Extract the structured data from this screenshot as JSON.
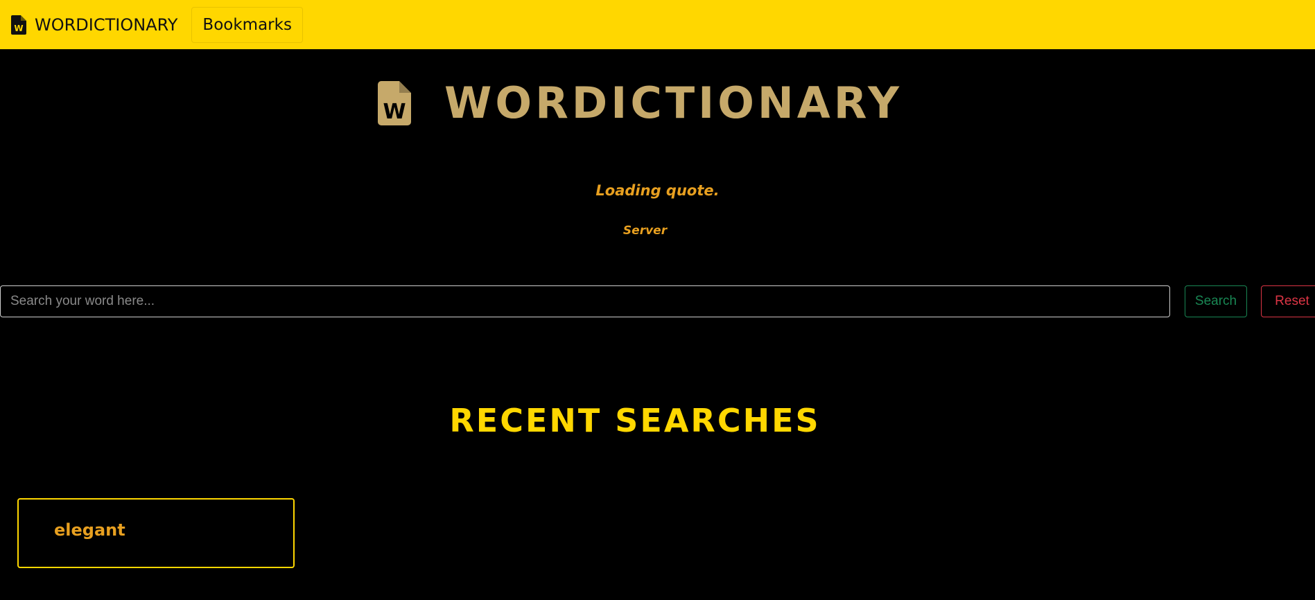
{
  "navbar": {
    "brand_label": "WORDICTIONARY",
    "brand_icon": "file-word-icon",
    "bookmarks_label": "Bookmarks",
    "background_color": "#FFD700"
  },
  "hero": {
    "title": "WORDICTIONARY",
    "icon": "file-word-icon",
    "color": "#C6A96A"
  },
  "quote": {
    "text": "Loading quote.",
    "author": "Server"
  },
  "search": {
    "placeholder": "Search your word here...",
    "value": "",
    "search_label": "Search",
    "reset_label": "Reset"
  },
  "recent": {
    "title": "RECENT SEARCHES",
    "items": [
      {
        "word": "elegant"
      }
    ]
  }
}
